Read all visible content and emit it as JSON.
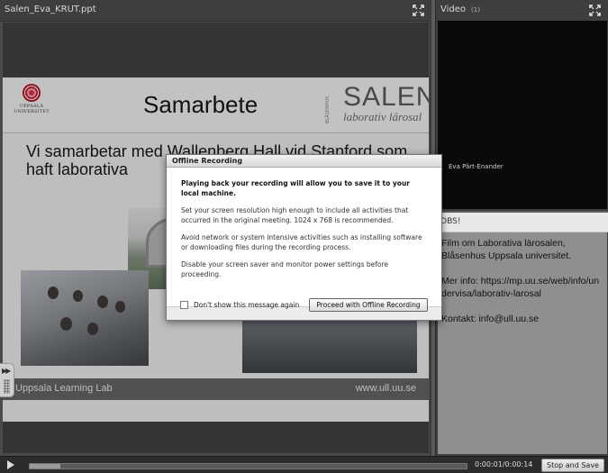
{
  "share_pod": {
    "title": "Salen_Eva_KRUT.ppt"
  },
  "slide": {
    "uu_name": "UPPSALA\nUNIVERSITET",
    "title": "Samarbete",
    "salen_logo": {
      "big": "SALEN",
      "small": "laborativ lärosal",
      "side": "BLÅSENHUS"
    },
    "body_text": "Vi samarbetar med Wallenberg Hall vid Stanford som haft laborativa",
    "footer_left": "Uppsala Learning Lab",
    "footer_right": "www.ull.uu.se"
  },
  "video_pod": {
    "title": "Video",
    "count": "(1)",
    "participant": "Eva Pärt-Enander"
  },
  "notes_pod": {
    "title": "OBS!",
    "paragraphs": [
      "Film om Laborativa lärosalen, Blåsenhus Uppsala universitet.",
      "Mer info: https://mp.uu.se/web/info/undervisa/laborativ-larosal",
      "Kontakt: info@ull.uu.se"
    ]
  },
  "playbar": {
    "progress_fraction": 0.07,
    "time": "0:00:01/0:00:14",
    "stop_save_label": "Stop and Save"
  },
  "dialog": {
    "title": "Offline Recording",
    "headline": "Playing back your recording will allow you to save it to your local machine.",
    "p1": "Set your screen resolution high enough to include all activities that occurred in the original meeting. 1024 x 768 is recommended.",
    "p2": "Avoid network or system intensive activities such as installing software or downloading files during the recording process.",
    "p3": "Disable your screen saver and monitor power settings before proceeding.",
    "checkbox_label": "Don't show this message again",
    "proceed_label": "Proceed with Offline Recording"
  }
}
